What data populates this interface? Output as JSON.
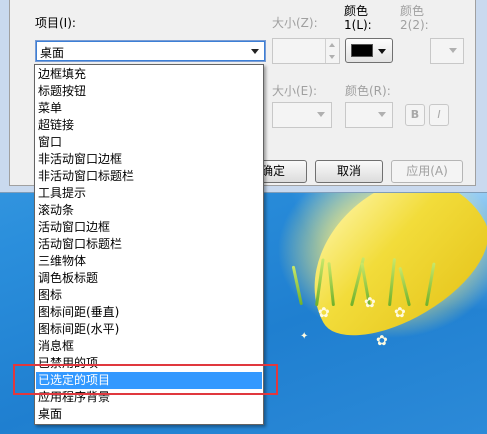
{
  "dialog": {
    "item_label": "项目(I):",
    "size_label": "大小(Z):",
    "color1_label_line1": "颜色",
    "color1_label_line2": "1(L):",
    "color2_label_line1": "颜色",
    "color2_label_line2": "2(2):",
    "font_size_label": "大小(E):",
    "font_color_label": "颜色(R):",
    "item_value": "桌面",
    "bold_label": "B",
    "italic_label": "I",
    "ok_label": "确定",
    "cancel_label": "取消",
    "apply_label": "应用(A)",
    "color1_value": "#000000"
  },
  "dropdown": {
    "items": [
      "边框填充",
      "标题按钮",
      "菜单",
      "超链接",
      "窗口",
      "非活动窗口边框",
      "非活动窗口标题栏",
      "工具提示",
      "滚动条",
      "活动窗口边框",
      "活动窗口标题栏",
      "三维物体",
      "调色板标题",
      "图标",
      "图标间距(垂直)",
      "图标间距(水平)",
      "消息框",
      "已禁用的项",
      "已选定的项目",
      "应用程序背景",
      "桌面"
    ],
    "selected_item": "已选定的项目"
  },
  "colors": {
    "selection": "#3399ff",
    "annotation": "#e0383e"
  }
}
